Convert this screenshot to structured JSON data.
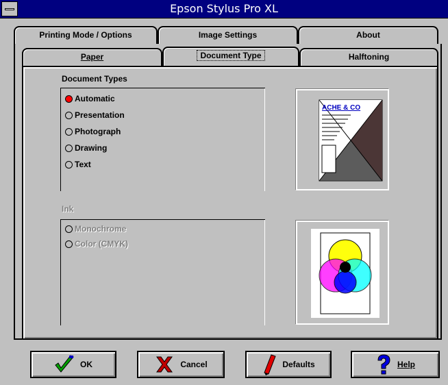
{
  "window": {
    "title": "Epson Stylus Pro XL"
  },
  "tabs_back": [
    {
      "label": "Printing Mode / Options",
      "underline": "M"
    },
    {
      "label": "Image Settings",
      "underline": "I"
    },
    {
      "label": "About",
      "underline": "b"
    }
  ],
  "tabs_front": [
    {
      "label": "Paper"
    },
    {
      "label": "Document Type",
      "active": true
    },
    {
      "label": "Halftoning"
    }
  ],
  "document_types": {
    "label": "Document Types",
    "options": [
      "Automatic",
      "Presentation",
      "Photograph",
      "Drawing",
      "Text"
    ],
    "selected": "Automatic"
  },
  "ink": {
    "label": "Ink",
    "options": [
      "Monochrome",
      "Color (CMYK)"
    ]
  },
  "preview_doc_text": "ACHE & CO",
  "buttons": [
    {
      "label": "OK"
    },
    {
      "label": "Cancel"
    },
    {
      "label": "Defaults"
    },
    {
      "label": "Help"
    }
  ],
  "colors": {
    "title_bg": "#000080",
    "face": "#c0c0c0",
    "selected_radio": "#ff0000"
  }
}
